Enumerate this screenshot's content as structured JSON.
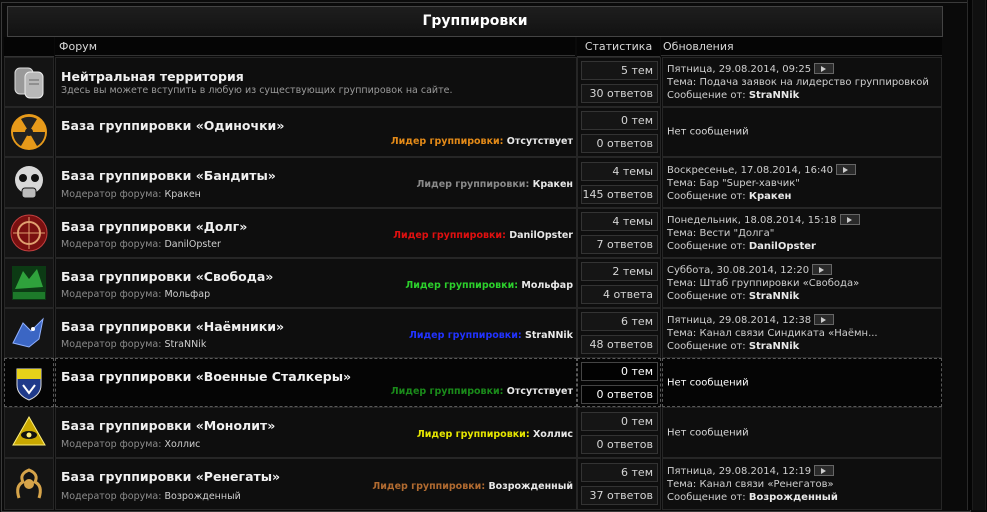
{
  "title": "Группировки",
  "headers": {
    "forum": "Форум",
    "stats": "Статистика",
    "updates": "Обновления"
  },
  "colors": {
    "leader_default": "#e6a800"
  },
  "forums": [
    {
      "icon": "dog-tags-icon",
      "name": "Нейтральная территория",
      "desc": "Здесь вы можете вступить в любую из существующих группировок на сайте.",
      "topics": "5 тем",
      "posts": "30 ответов",
      "upd1": "Пятница, 29.08.2014, 09:25",
      "upd2": "Тема: Подача заявок на лидерство группировкой",
      "upd3_label": "Сообщение от: ",
      "upd3_user": "StraNNik"
    },
    {
      "icon": "radiation-sign-icon",
      "name": "База группировки «Одиночки»",
      "leader_label": "Лидер группировки:",
      "leader_value": "Отсутствует",
      "leader_color": "#e38a18",
      "topics": "0 тем",
      "posts": "0 ответов",
      "nomsg": "Нет сообщений"
    },
    {
      "icon": "skull-gasmask-icon",
      "name": "База группировки «Бандиты»",
      "mod_label": "Модератор форума:",
      "mod_value": "Кракен",
      "leader_label": "Лидер группировки:",
      "leader_value": "Кракен",
      "leader_color": "#8a8a8a",
      "topics": "4 темы",
      "posts": "145 ответов",
      "upd1": "Воскресенье, 17.08.2014, 16:40",
      "upd2": "Тема: Бар \"Super-хавчик\"",
      "upd3_label": "Сообщение от: ",
      "upd3_user": "Кракен"
    },
    {
      "icon": "duty-emblem-icon",
      "name": "База группировки «Долг»",
      "mod_label": "Модератор форума:",
      "mod_value": "DanilOpster",
      "leader_label": "Лидер группировки:",
      "leader_value": "DanilOpster",
      "leader_color": "#e01010",
      "topics": "4 темы",
      "posts": "7 ответов",
      "upd1": "Понедельник, 18.08.2014, 15:18",
      "upd2": "Тема: Вести \"Долга\"",
      "upd3_label": "Сообщение от: ",
      "upd3_user": "DanilOpster"
    },
    {
      "icon": "freedom-wolf-icon",
      "name": "База группировки «Свобода»",
      "mod_label": "Модератор форума:",
      "mod_value": "Мольфар",
      "leader_label": "Лидер группировки:",
      "leader_value": "Мольфар",
      "leader_color": "#2cd02c",
      "topics": "2 темы",
      "posts": "4 ответа",
      "upd1": "Суббота, 30.08.2014, 12:20",
      "upd2": "Тема: Штаб группировки «Свобода»",
      "upd3_label": "Сообщение от: ",
      "upd3_user": "StraNNik"
    },
    {
      "icon": "mercenary-griffin-icon",
      "name": "База группировки «Наёмники»",
      "mod_label": "Модератор форума:",
      "mod_value": "StraNNik",
      "leader_label": "Лидер группировки:",
      "leader_value": "StraNNik",
      "leader_color": "#2233ff",
      "topics": "6 тем",
      "posts": "48 ответов",
      "upd1": "Пятница, 29.08.2014, 12:38",
      "upd2": "Тема: Канал связи Синдиката «Наёмн...",
      "upd3_label": "Сообщение от: ",
      "upd3_user": "StraNNik"
    },
    {
      "icon": "military-shield-icon",
      "name": "База группировки «Военные Сталкеры»",
      "leader_label": "Лидер группировки:",
      "leader_value": "Отсутствует",
      "leader_color": "#1a8a1a",
      "topics": "0 тем",
      "posts": "0 ответов",
      "nomsg": "Нет сообщений",
      "highlight": true
    },
    {
      "icon": "monolith-eye-icon",
      "name": "База группировки «Монолит»",
      "mod_label": "Модератор форума:",
      "mod_value": "Холлис",
      "leader_label": "Лидер группировки:",
      "leader_value": "Холлис",
      "leader_color": "#e6e600",
      "topics": "0 тем",
      "posts": "0 ответов",
      "nomsg": "Нет сообщений"
    },
    {
      "icon": "renegade-scorpion-icon",
      "name": "База группировки «Ренегаты»",
      "mod_label": "Модератор форума:",
      "mod_value": "Возрожденный",
      "leader_label": "Лидер группировки:",
      "leader_value": "Возрожденный",
      "leader_color": "#b06a30",
      "topics": "6 тем",
      "posts": "37 ответов",
      "upd1": "Пятница, 29.08.2014, 12:19",
      "upd2": "Тема: Канал связи «Ренегатов»",
      "upd3_label": "Сообщение от: ",
      "upd3_user": "Возрожденный"
    }
  ]
}
